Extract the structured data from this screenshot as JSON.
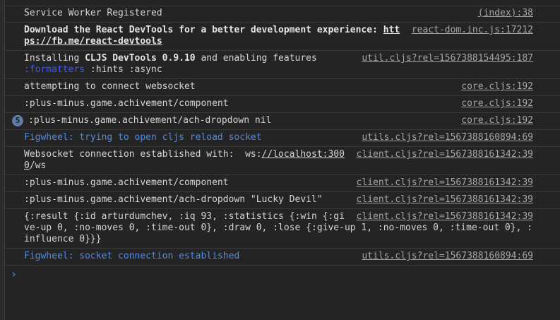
{
  "console": {
    "rows": [
      {
        "message": "Service Worker Registered",
        "source": "(index):38"
      },
      {
        "message_bold": "Download the React DevTools for a better development experience: ",
        "message_link": "https://fb.me/react-devtools",
        "source": "react-dom.inc.js:17212"
      },
      {
        "message_pre": "Installing ",
        "message_bold": "CLJS DevTools 0.9.10",
        "message_mid": " and enabling features",
        "message_feature": ":formatters",
        "message_post": " :hints :async",
        "source": "util.cljs?rel=1567388154495:187"
      },
      {
        "message": "attempting to connect websocket",
        "source": "core.cljs:192"
      },
      {
        "message": ":plus-minus.game.achivement/component",
        "source": "core.cljs:192"
      },
      {
        "badge": "5",
        "message": ":plus-minus.game.achivement/ach-dropdown nil",
        "source": "core.cljs:192"
      },
      {
        "message": "Figwheel: trying to open cljs reload socket",
        "source": "utils.cljs?rel=1567388160894:69"
      },
      {
        "message_pre": "Websocket connection established with:  ws:",
        "message_link": "//localhost:3000",
        "message_post": "/ws",
        "source": "client.cljs?rel=1567388161342:39"
      },
      {
        "message": ":plus-minus.game.achivement/component",
        "source": "client.cljs?rel=1567388161342:39"
      },
      {
        "message": ":plus-minus.game.achivement/ach-dropdown \"Lucky Devil\"",
        "source": "client.cljs?rel=1567388161342:39"
      },
      {
        "message": "{:result {:id arturdumchev, :iq 93, :statistics {:win {:give-up 0, :no-moves 0, :time-out 0}, :draw 0, :lose {:give-up 1, :no-moves 0, :time-out 0}, :influence 0}}}",
        "source": "client.cljs?rel=1567388161342:39"
      },
      {
        "message": "Figwheel: socket connection established",
        "source": "utils.cljs?rel=1567388160894:69"
      }
    ],
    "prompt_glyph": "›"
  },
  "colors": {
    "background": "#242424",
    "text": "#d5d5d5",
    "info_blue": "#4f8be2",
    "formatter_blue": "#3b59ff",
    "source_link": "#a5a5a5",
    "badge": "#5f7da4"
  }
}
